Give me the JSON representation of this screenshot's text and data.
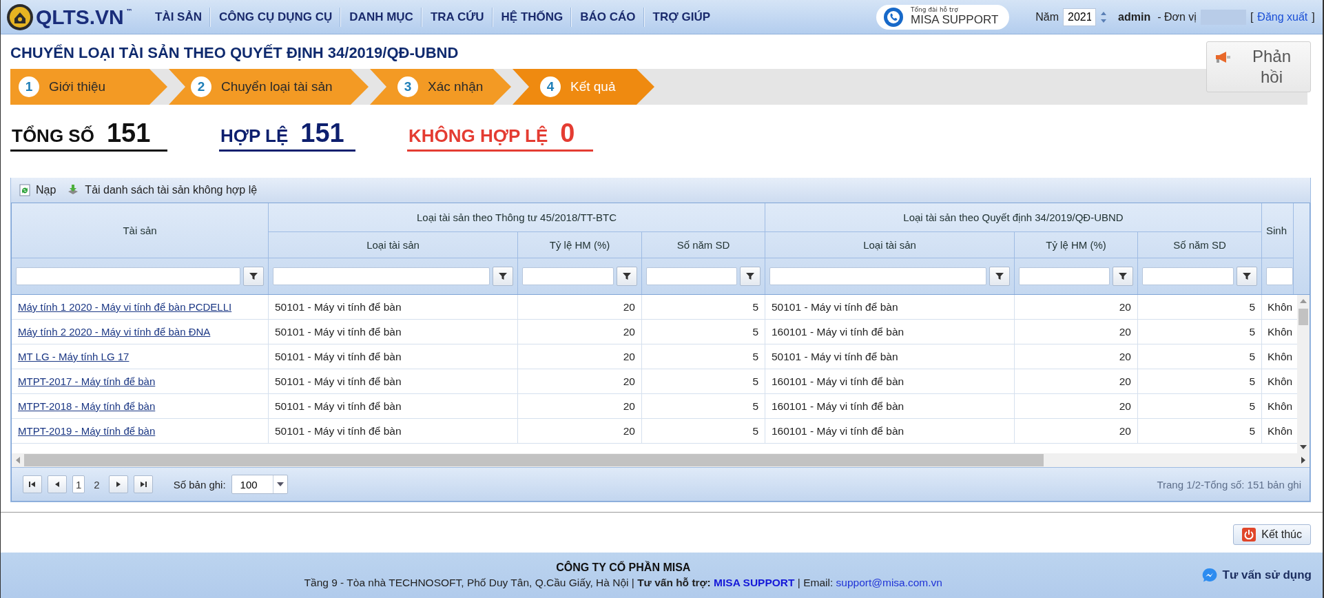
{
  "logo": {
    "text": "QLTS.VN",
    "mark": "™"
  },
  "menu": [
    {
      "label": "TÀI SẢN"
    },
    {
      "label": "CÔNG CỤ DỤNG CỤ"
    },
    {
      "label": "DANH MỤC"
    },
    {
      "label": "TRA CỨU"
    },
    {
      "label": "HỆ THỐNG"
    },
    {
      "label": "BÁO CÁO"
    },
    {
      "label": "TRỢ GIÚP"
    }
  ],
  "support": {
    "caption": "Tổng đài hỗ trợ",
    "name": "MISA SUPPORT"
  },
  "year": {
    "label": "Năm",
    "value": "2021"
  },
  "user": {
    "name": "admin",
    "unit_label": "- Đơn vị",
    "logout_open": "[",
    "logout": "Đăng xuất",
    "logout_close": "]"
  },
  "page_title": "CHUYỂN LOẠI TÀI SẢN THEO QUYẾT ĐỊNH 34/2019/QĐ-UBND",
  "feedback_button": "Phản hồi",
  "steps": [
    {
      "number": "1",
      "label": "Giới thiệu",
      "selected": false
    },
    {
      "number": "2",
      "label": "Chuyển loại tài sản",
      "selected": false
    },
    {
      "number": "3",
      "label": "Xác nhận",
      "selected": false
    },
    {
      "number": "4",
      "label": "Kết quả",
      "selected": true
    }
  ],
  "totals": [
    {
      "kind": "total",
      "label": "TỔNG SỐ",
      "value": "151"
    },
    {
      "kind": "valid",
      "label": "HỢP LỆ",
      "value": "151"
    },
    {
      "kind": "invalid",
      "label": "KHÔNG HỢP LỆ",
      "value": "0"
    }
  ],
  "toolbar": [
    {
      "kind": "reload",
      "label": "Nạp"
    },
    {
      "kind": "download",
      "label": "Tải danh sách tài sản không hợp lệ"
    }
  ],
  "table": {
    "groups": [
      "Loại tài sản theo Thông tư 45/2018/TT-BTC",
      "Loại tài sản theo Quyết định 34/2019/QĐ-UBND"
    ],
    "first_column": "Tài sản",
    "last_column": "Sinh",
    "subcolumns": [
      "Loại tài sản",
      "Tỷ lệ HM (%)",
      "Số năm SD",
      "Loại tài sản",
      "Tỷ lệ HM (%)",
      "Số năm SD"
    ],
    "rows": [
      {
        "asset": "Máy tính 1 2020 - Máy vi tính để bàn PCDELLI",
        "cells": [
          "50101 - Máy vi tính để bàn",
          "20",
          "5",
          "50101 - Máy vi tính để bàn",
          "20",
          "5"
        ],
        "last": "Khôn"
      },
      {
        "asset": "Máy tính 2 2020 - Máy vi tính để bàn ĐNA",
        "cells": [
          "50101 - Máy vi tính để bàn",
          "20",
          "5",
          "160101 - Máy vi tính để bàn",
          "20",
          "5"
        ],
        "last": "Khôn"
      },
      {
        "asset": "MT LG - Máy tính LG 17",
        "cells": [
          "50101 - Máy vi tính để bàn",
          "20",
          "5",
          "50101 - Máy vi tính để bàn",
          "20",
          "5"
        ],
        "last": "Khôn"
      },
      {
        "asset": "MTPT-2017 - Máy tính để bàn",
        "cells": [
          "50101 - Máy vi tính để bàn",
          "20",
          "5",
          "160101 - Máy vi tính để bàn",
          "20",
          "5"
        ],
        "last": "Khôn"
      },
      {
        "asset": "MTPT-2018 - Máy tính để bàn",
        "cells": [
          "50101 - Máy vi tính để bàn",
          "20",
          "5",
          "160101 - Máy vi tính để bàn",
          "20",
          "5"
        ],
        "last": "Khôn"
      },
      {
        "asset": "MTPT-2019 - Máy tính để bàn",
        "cells": [
          "50101 - Máy vi tính để bàn",
          "20",
          "5",
          "160101 - Máy vi tính để bàn",
          "20",
          "5"
        ],
        "last": "Khôn"
      }
    ]
  },
  "pager": {
    "pages": [
      {
        "label": "1",
        "selected": true
      },
      {
        "label": "2",
        "selected": false
      }
    ],
    "size_label": "Số bản ghi:",
    "size": "100",
    "summary": "Trang 1/2-Tổng số: 151 bản ghi"
  },
  "finish_button": "Kết thúc",
  "footer": {
    "company": "CÔNG TY CỔ PHẦN MISA",
    "address": "Tầng 9 - Tòa nhà TECHNOSOFT, Phố Duy Tân, Q.Cầu Giấy, Hà Nội | **Tư vấn hỗ trợ:**",
    "support_link": "MISA SUPPORT",
    "email_label": "| Email:",
    "email": "support@misa.com.vn",
    "chat": "Tư vấn sử dụng"
  }
}
